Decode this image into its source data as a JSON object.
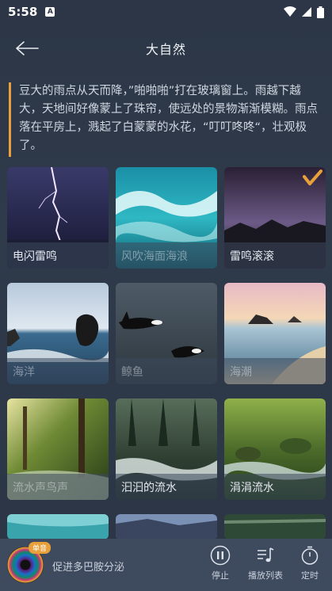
{
  "status": {
    "time": "5:58",
    "notif_letter": "A"
  },
  "header": {
    "title": "大自然"
  },
  "description": "豆大的雨点从天而降，”啪啪啪”打在玻璃窗上。雨越下越大，天地间好像蒙上了珠帘，使远处的景物渐渐模糊。雨点落在平房上，溅起了白蒙蒙的水花，“叮叮咚咚“，壮观极了。",
  "tiles": [
    {
      "label": "电闪雷鸣",
      "selected": false
    },
    {
      "label": "风吹海面海浪",
      "selected": false
    },
    {
      "label": "雷鸣滚滚",
      "selected": true
    },
    {
      "label": "海洋",
      "selected": false
    },
    {
      "label": "鲸鱼",
      "selected": false
    },
    {
      "label": "海潮",
      "selected": false
    },
    {
      "label": "流水声鸟声",
      "selected": false
    },
    {
      "label": "汩汩的流水",
      "selected": false
    },
    {
      "label": "涓涓流水",
      "selected": false
    }
  ],
  "player": {
    "badge": "单音",
    "track": "促进多巴胺分泌",
    "stop_label": "停止",
    "playlist_label": "播放列表",
    "timer_label": "定时"
  },
  "colors": {
    "accent": "#e8a03a",
    "background": "#2f3a4b",
    "player_bg": "#3e4a5d"
  }
}
